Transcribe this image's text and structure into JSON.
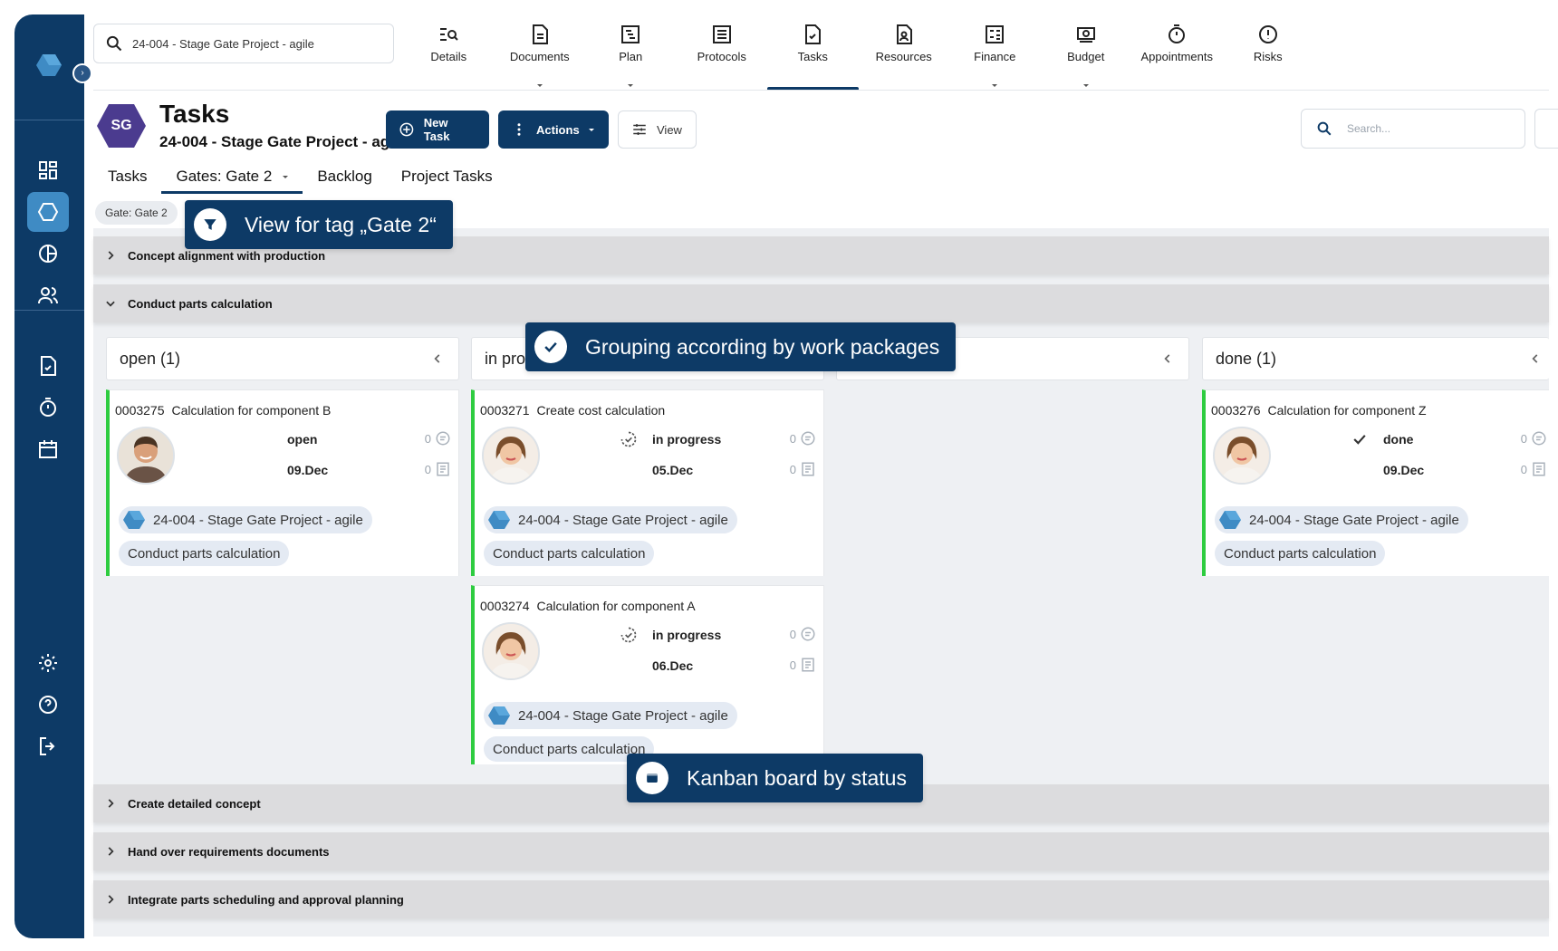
{
  "project_search": {
    "value": "24-004 - Stage Gate Project - agile"
  },
  "topnav": [
    {
      "label": "Details",
      "icon": "details-icon"
    },
    {
      "label": "Documents",
      "icon": "document-icon"
    },
    {
      "label": "Plan",
      "icon": "plan-icon"
    },
    {
      "label": "Protocols",
      "icon": "protocol-icon"
    },
    {
      "label": "Tasks",
      "icon": "tasks-icon"
    },
    {
      "label": "Resources",
      "icon": "resources-icon"
    },
    {
      "label": "Finance",
      "icon": "finance-icon"
    },
    {
      "label": "Budget",
      "icon": "budget-icon"
    },
    {
      "label": "Appointments",
      "icon": "stopwatch-icon"
    },
    {
      "label": "Risks",
      "icon": "risk-icon"
    }
  ],
  "header": {
    "badge": "SG",
    "title": "Tasks",
    "subtitle": "24-004 - Stage Gate Project - agile",
    "new_task": "New Task",
    "actions": "Actions",
    "view": "View",
    "search_placeholder": "Search..."
  },
  "tabs": [
    {
      "label": "Tasks"
    },
    {
      "label": "Gates: Gate 2"
    },
    {
      "label": "Backlog"
    },
    {
      "label": "Project Tasks"
    }
  ],
  "filter_chip": "Gate: Gate 2",
  "groups": [
    {
      "label": "Concept alignment with production",
      "expanded": false
    },
    {
      "label": "Conduct parts calculation",
      "expanded": true
    },
    {
      "label": "Create detailed concept",
      "expanded": false
    },
    {
      "label": "Hand over requirements documents",
      "expanded": false
    },
    {
      "label": "Integrate parts scheduling and approval planning",
      "expanded": false
    }
  ],
  "columns": [
    {
      "label": "open (1)"
    },
    {
      "label": "in pro"
    },
    {
      "label": ""
    },
    {
      "label": "done (1)"
    }
  ],
  "cards": [
    {
      "id": "0003275",
      "title": "Calculation for component B",
      "status": "open",
      "due": "09.Dec",
      "comments": "0",
      "notes": "0",
      "project": "24-004 - Stage Gate Project - agile",
      "package": "Conduct parts calculation",
      "avatar": "male"
    },
    {
      "id": "0003271",
      "title": "Create cost calculation",
      "status": "in progress",
      "due": "05.Dec",
      "comments": "0",
      "notes": "0",
      "project": "24-004 - Stage Gate Project - agile",
      "package": "Conduct parts calculation",
      "avatar": "female"
    },
    {
      "id": "0003274",
      "title": "Calculation for component A",
      "status": "in progress",
      "due": "06.Dec",
      "comments": "0",
      "notes": "0",
      "project": "24-004 - Stage Gate Project - agile",
      "package": "Conduct parts calculation",
      "avatar": "female"
    },
    {
      "id": "0003276",
      "title": "Calculation for component Z",
      "status": "done",
      "due": "09.Dec",
      "comments": "0",
      "notes": "0",
      "project": "24-004 - Stage Gate Project - agile",
      "package": "Conduct parts calculation",
      "avatar": "female"
    }
  ],
  "callouts": {
    "tag_view": "View for tag „Gate 2“",
    "grouping": "Grouping according by work packages",
    "kanban": "Kanban board by status"
  },
  "colors": {
    "navy": "#0d3a66",
    "accent_green": "#2ecc40",
    "active_blue": "#3f8bc4",
    "badge_purple": "#4b3b8f"
  }
}
